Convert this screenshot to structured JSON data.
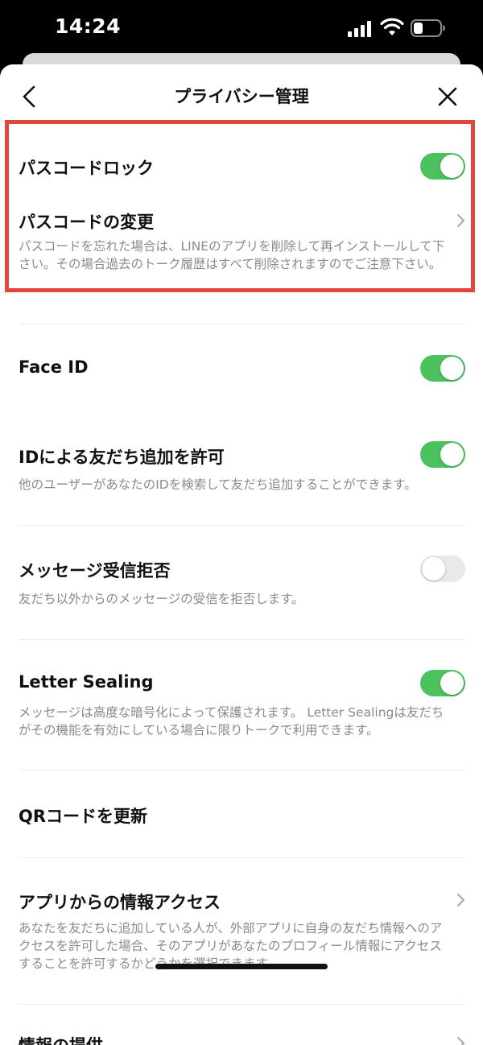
{
  "status": {
    "time": "14:24"
  },
  "header": {
    "title": "プライバシー管理"
  },
  "settings": {
    "passcode_lock": {
      "label": "パスコードロック",
      "enabled": true
    },
    "passcode_change": {
      "label": "パスコードの変更",
      "description": "パスコードを忘れた場合は、LINEのアプリを削除して再インストールして下さい。その場合過去のトーク履歴はすべて削除されますのでご注意下さい。"
    },
    "face_id": {
      "label": "Face ID",
      "enabled": true
    },
    "id_add_friend": {
      "label": "IDによる友だち追加を許可",
      "description": "他のユーザーがあなたのIDを検索して友だち追加することができます。",
      "enabled": true
    },
    "message_reject": {
      "label": "メッセージ受信拒否",
      "description": "友だち以外からのメッセージの受信を拒否します。",
      "enabled": false
    },
    "letter_sealing": {
      "label": "Letter Sealing",
      "description": "メッセージは高度な暗号化によって保護されます。 Letter Sealingは友だちがその機能を有効にしている場合に限りトークで利用できます。",
      "enabled": true
    },
    "qr_update": {
      "label": "QRコードを更新"
    },
    "app_info_access": {
      "label": "アプリからの情報アクセス",
      "description": "あなたを友だちに追加している人が、外部アプリに自身の友だち情報へのアクセスを許可した場合、そのアプリがあなたのプロフィール情報にアクセスすることを許可するかどうかを選択できます。"
    },
    "info_provision": {
      "label": "情報の提供"
    }
  },
  "colors": {
    "toggle_on": "#4cc25f",
    "toggle_off": "#e9e9ea",
    "highlight": "#e3473b"
  },
  "icons": {
    "back": "chevron-left-icon",
    "close": "close-icon",
    "row_chevron": "chevron-right-icon",
    "signal": "cellular-signal-icon",
    "wifi": "wifi-icon",
    "battery": "battery-icon"
  }
}
